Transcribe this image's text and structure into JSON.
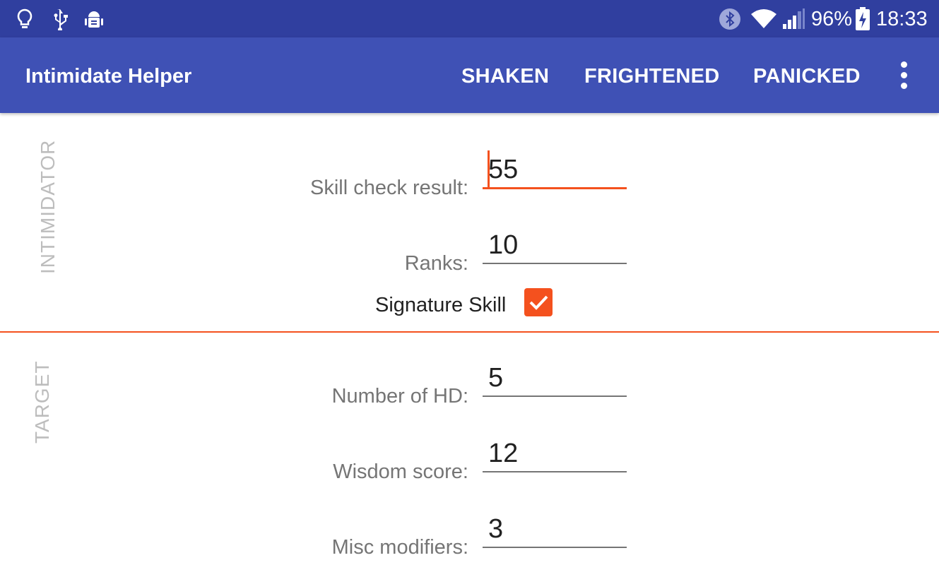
{
  "status_bar": {
    "battery": "96%",
    "time": "18:33",
    "icons": [
      "lightbulb-icon",
      "usb-icon",
      "android-debug-icon",
      "bluetooth-icon",
      "wifi-icon",
      "signal-icon",
      "battery-charging-icon"
    ]
  },
  "app_bar": {
    "title": "Intimidate Helper",
    "actions": [
      "SHAKEN",
      "FRIGHTENED",
      "PANICKED"
    ],
    "overflow_icon": "more-vert-icon"
  },
  "intimidator": {
    "section_label": "INTIMIDATOR",
    "skill_check_label": "Skill check result:",
    "skill_check_value": "55",
    "ranks_label": "Ranks:",
    "ranks_value": "10",
    "signature_label": "Signature Skill",
    "signature_checked": true
  },
  "target": {
    "section_label": "TARGET",
    "hd_label": "Number of HD:",
    "hd_value": "5",
    "wisdom_label": "Wisdom score:",
    "wisdom_value": "12",
    "misc_label": "Misc modifiers:",
    "misc_value": "3"
  },
  "colors": {
    "status_bar": "#303F9F",
    "app_bar": "#3F51B5",
    "accent": "#F4511E"
  }
}
